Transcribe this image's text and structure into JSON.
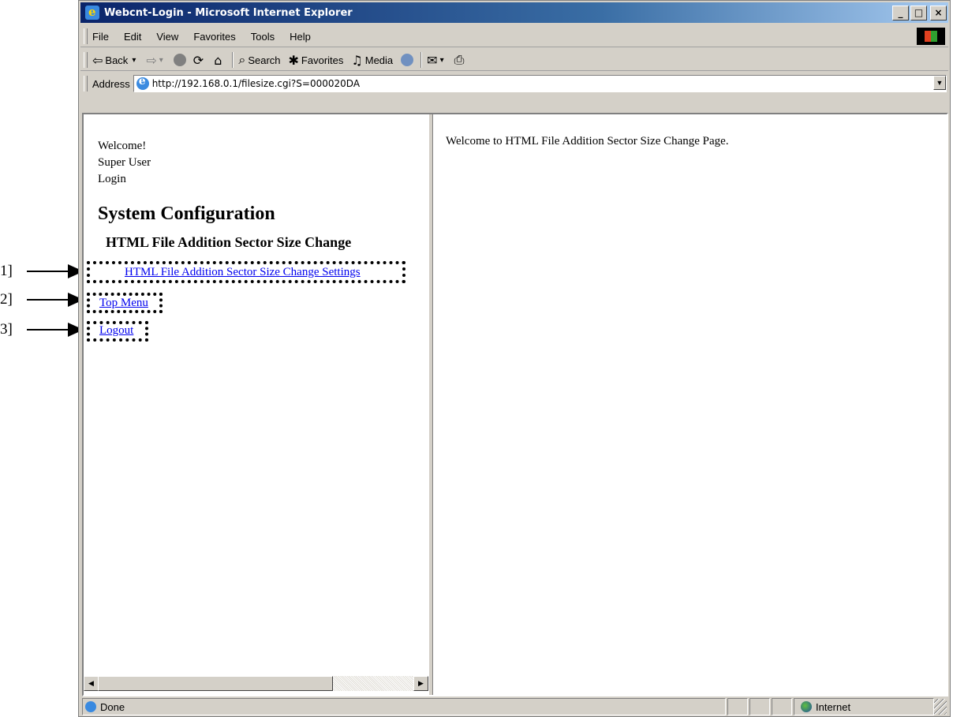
{
  "callouts": [
    "1]",
    "2]",
    "3]"
  ],
  "window": {
    "title": "Webcnt-Login - Microsoft Internet Explorer",
    "minimize": "_",
    "maximize": "□",
    "close": "×"
  },
  "menu": [
    "File",
    "Edit",
    "View",
    "Favorites",
    "Tools",
    "Help"
  ],
  "toolbar": {
    "back_label": "Back",
    "search_label": "Search",
    "favorites_label": "Favorites",
    "media_label": "Media"
  },
  "address": {
    "label": "Address",
    "url": "http://192.168.0.1/filesize.cgi?S=000020DA"
  },
  "left_frame": {
    "welcome": "Welcome!",
    "user": "Super User",
    "login": "Login",
    "heading": "System Configuration",
    "subheading": "HTML File Addition Sector Size Change",
    "links": {
      "settings": "HTML File Addition Sector Size Change Settings",
      "top_menu": "Top Menu",
      "logout": "Logout"
    }
  },
  "right_frame": {
    "message": "Welcome to HTML File Addition Sector Size Change Page."
  },
  "status": {
    "text": "Done",
    "zone": "Internet"
  },
  "colors": {
    "titlebar_start": "#0a246a",
    "titlebar_end": "#a6caf0",
    "chrome": "#d4d0c8",
    "link": "#0000ee"
  }
}
